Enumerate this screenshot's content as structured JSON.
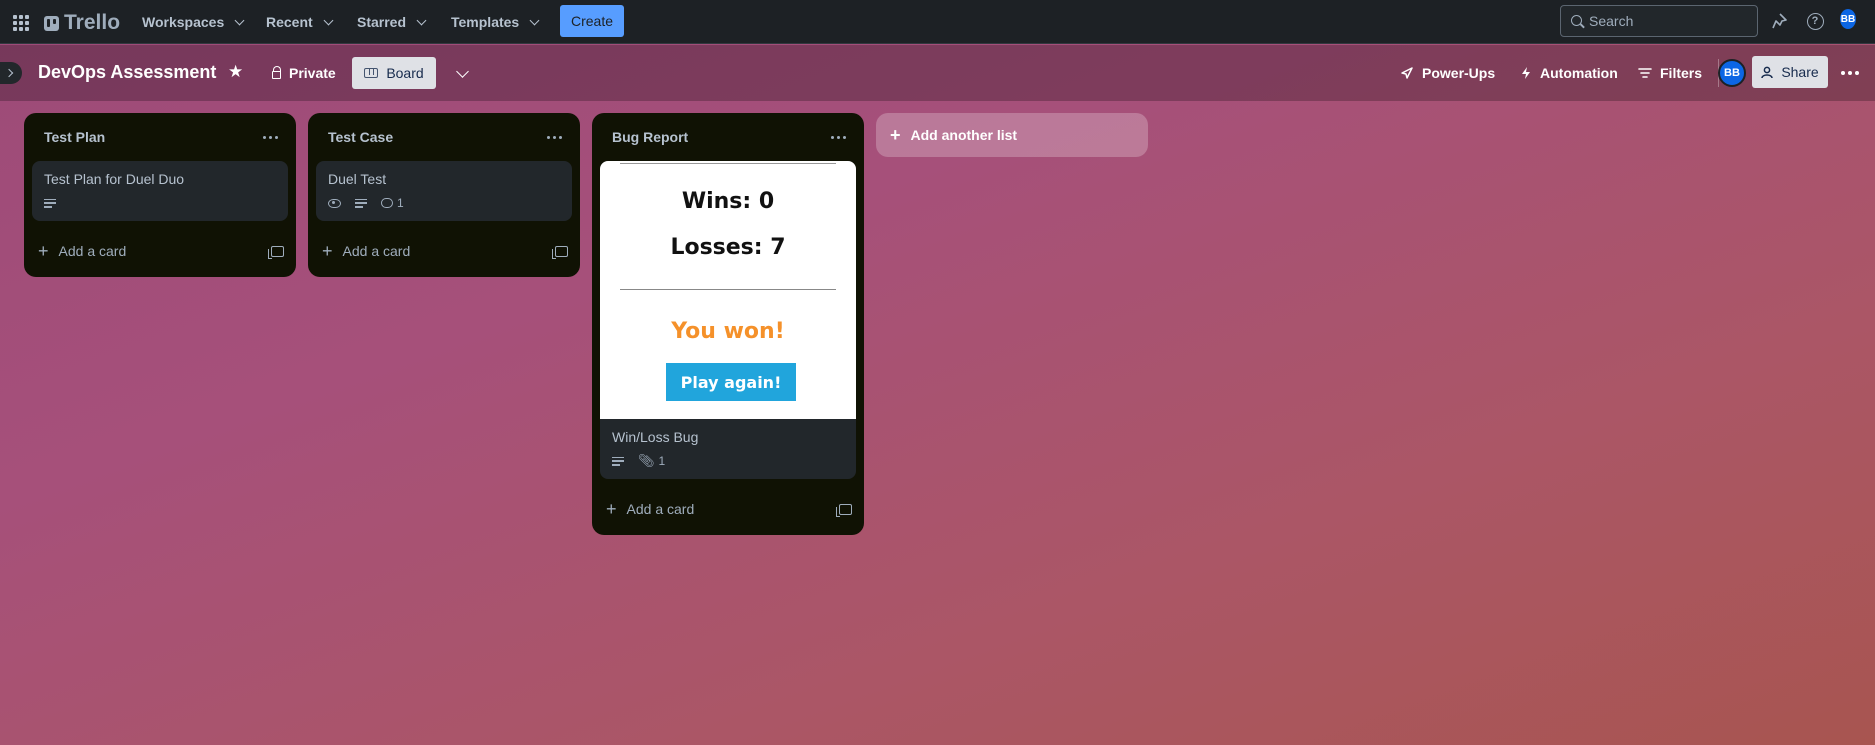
{
  "nav": {
    "logo": "Trello",
    "workspaces": "Workspaces",
    "recent": "Recent",
    "starred": "Starred",
    "templates": "Templates",
    "create": "Create",
    "search_placeholder": "Search",
    "avatar_initials": "BB"
  },
  "board": {
    "title": "DevOps Assessment",
    "visibility": "Private",
    "view": "Board",
    "power_ups": "Power-Ups",
    "automation": "Automation",
    "filters": "Filters",
    "member_initials": "BB",
    "share": "Share",
    "add_list": "Add another list"
  },
  "lists": [
    {
      "title": "Test Plan",
      "cards": [
        {
          "title": "Test Plan for Duel Duo"
        }
      ],
      "add_card": "Add a card"
    },
    {
      "title": "Test Case",
      "cards": [
        {
          "title": "Duel Test",
          "comments": "1"
        }
      ],
      "add_card": "Add a card"
    },
    {
      "title": "Bug Report",
      "cards": [
        {
          "title": "Win/Loss Bug",
          "attachments": "1",
          "cover": {
            "wins": "Wins: 0",
            "losses": "Losses: 7",
            "result": "You won!",
            "button": "Play again!"
          }
        }
      ],
      "add_card": "Add a card"
    }
  ],
  "colors": {
    "nav_bg": "#1d2125",
    "list_bg": "#101204",
    "card_bg": "#22272b",
    "create_button": "#579dff",
    "cover_result": "#f5912a",
    "cover_button": "#21a5dc"
  }
}
